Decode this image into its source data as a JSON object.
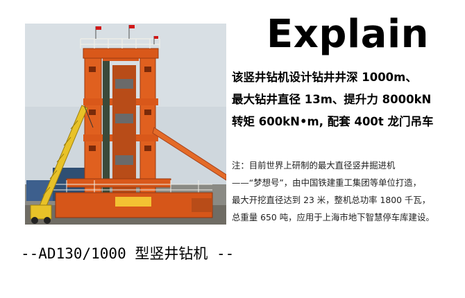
{
  "header": {
    "title": "Explain"
  },
  "specs": [
    "该竖井钻机设计钻井井深 1000m、",
    "最大钻井直径 13m、提升力 8000kN",
    "转矩 600kN•m, 配套 400t 龙门吊车"
  ],
  "note": [
    "注：目前世界上研制的最大直径竖井掘进机",
    "——“梦想号”，由中国铁建重工集团等单位打造，",
    "最大开挖直径达到 23 米，整机总功率 1800 千瓦，",
    "总重量 650 吨，应用于上海市地下智慧停车库建设。"
  ],
  "caption": "--AD130/1000 型竖井钻机 --",
  "colors": {
    "rig_orange": "#e0601f",
    "crane_yellow": "#e8c228",
    "sky": "#cdd6dc"
  }
}
